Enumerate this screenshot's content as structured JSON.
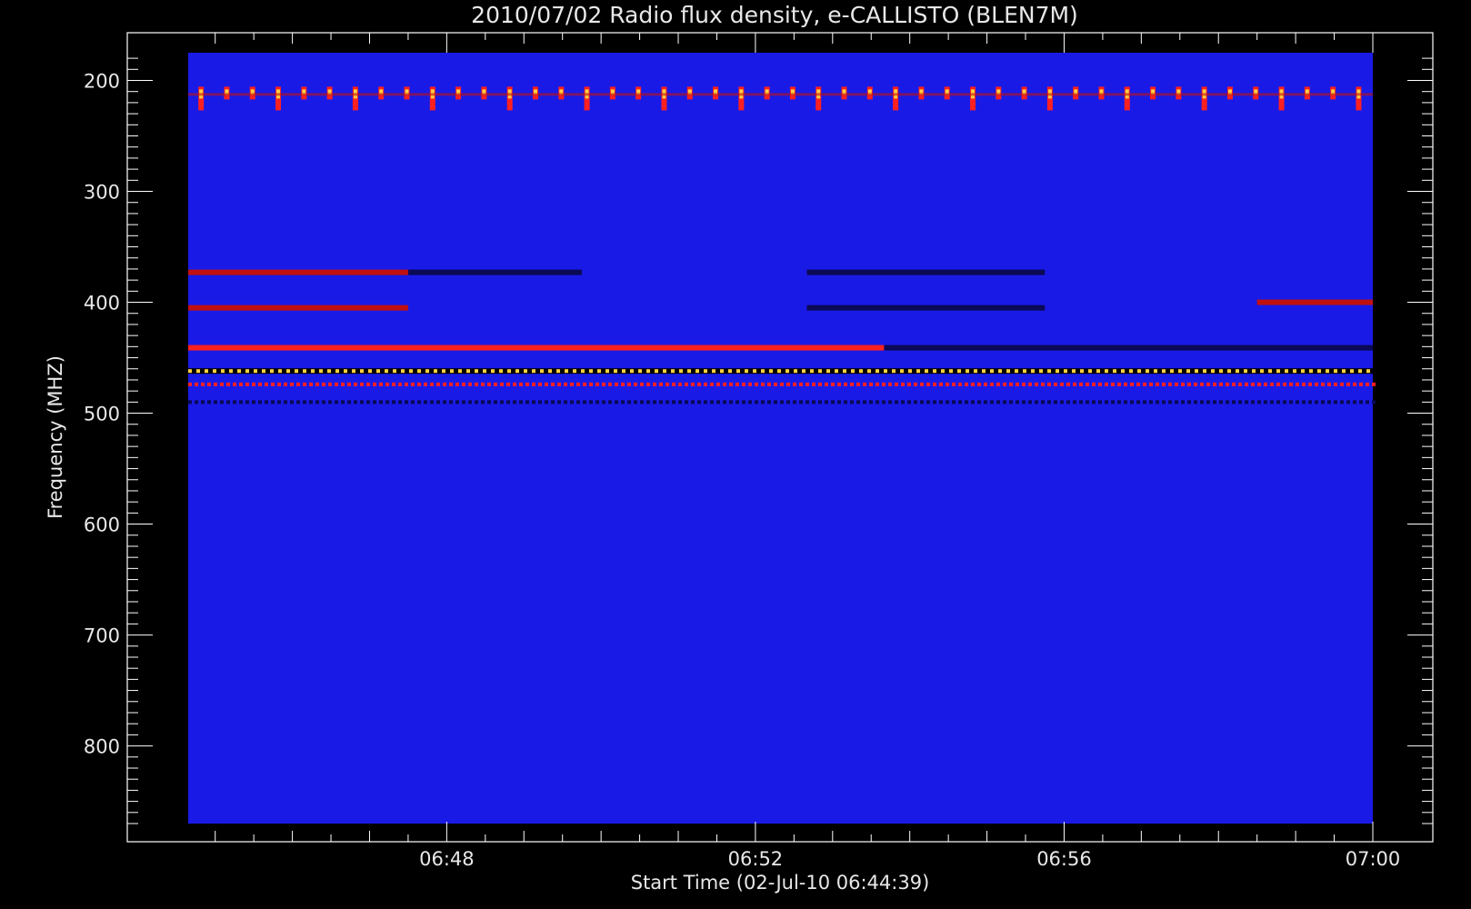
{
  "chart_data": {
    "type": "heatmap",
    "title": "2010/07/02  Radio flux density, e-CALLISTO (BLEN7M)",
    "xlabel": "Start Time (02-Jul-10 06:44:39)",
    "ylabel": "Frequency (MHZ)",
    "x_range_minutes": [
      "06:44:39",
      "07:00:00"
    ],
    "x_ticks": [
      "06:48",
      "06:52",
      "06:56",
      "07:00"
    ],
    "y_range_mhz": [
      175,
      870
    ],
    "y_reversed": true,
    "y_ticks": [
      200,
      300,
      400,
      500,
      600,
      700,
      800
    ],
    "colors": {
      "background": "#1a1ae6",
      "low": "#0a0a55",
      "mid": "#c01010",
      "high": "#ff2020",
      "peak": "#ffd040",
      "axis": "#ffffff"
    },
    "features": [
      {
        "kind": "pulse_train",
        "freq_mhz": 213,
        "start": "06:44:39",
        "end": "07:00:00",
        "period_s": 20
      },
      {
        "kind": "band",
        "freq_mhz": 441,
        "start": "06:44:39",
        "end": "06:53:40",
        "level": "high"
      },
      {
        "kind": "band",
        "freq_mhz": 441,
        "start": "06:53:40",
        "end": "07:00:00",
        "level": "low"
      },
      {
        "kind": "band",
        "freq_mhz": 462,
        "start": "06:44:39",
        "end": "07:00:00",
        "level": "mixed"
      },
      {
        "kind": "band",
        "freq_mhz": 474,
        "start": "06:44:39",
        "end": "07:00:00",
        "level": "dotted"
      },
      {
        "kind": "band",
        "freq_mhz": 490,
        "start": "06:44:39",
        "end": "07:00:00",
        "level": "dotted-dark"
      },
      {
        "kind": "band",
        "freq_mhz": 373,
        "start": "06:44:39",
        "end": "06:47:30",
        "level": "mid"
      },
      {
        "kind": "band",
        "freq_mhz": 373,
        "start": "06:47:30",
        "end": "06:49:45",
        "level": "low"
      },
      {
        "kind": "band",
        "freq_mhz": 373,
        "start": "06:52:40",
        "end": "06:55:45",
        "level": "low"
      },
      {
        "kind": "band",
        "freq_mhz": 405,
        "start": "06:44:39",
        "end": "06:47:30",
        "level": "mid"
      },
      {
        "kind": "band",
        "freq_mhz": 405,
        "start": "06:52:40",
        "end": "06:55:45",
        "level": "low"
      },
      {
        "kind": "band",
        "freq_mhz": 400,
        "start": "06:58:30",
        "end": "07:00:00",
        "level": "mid"
      }
    ]
  }
}
